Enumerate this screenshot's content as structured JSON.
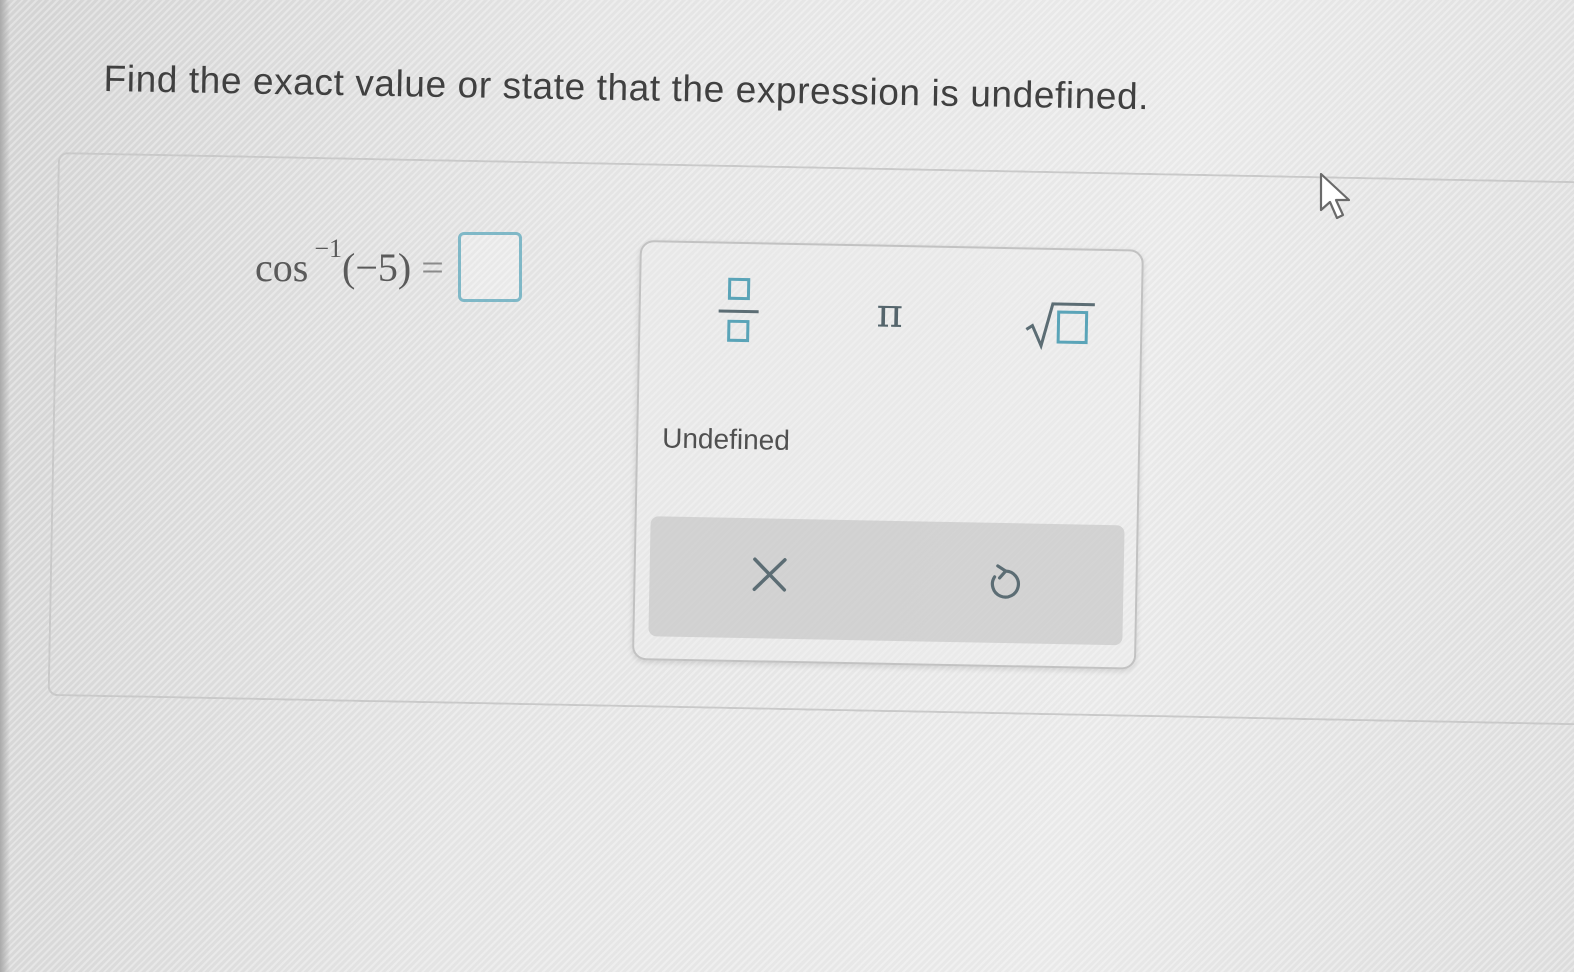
{
  "question": {
    "prompt": "Find the exact value or state that the expression is undefined."
  },
  "equation": {
    "func": "cos",
    "exponent": "−1",
    "argument": "(−5)",
    "equals": "=",
    "answer_value": ""
  },
  "palette": {
    "fraction_icon": "fraction-template-icon",
    "pi_symbol": "π",
    "sqrt_icon": "square-root-template-icon",
    "undefined_label": "Undefined",
    "clear_icon": "close-x-icon",
    "undo_icon": "undo-icon"
  },
  "colors": {
    "accent_teal": "#5aa4b8",
    "answer_border": "#7fb8c7",
    "action_bar": "#bebebe"
  }
}
